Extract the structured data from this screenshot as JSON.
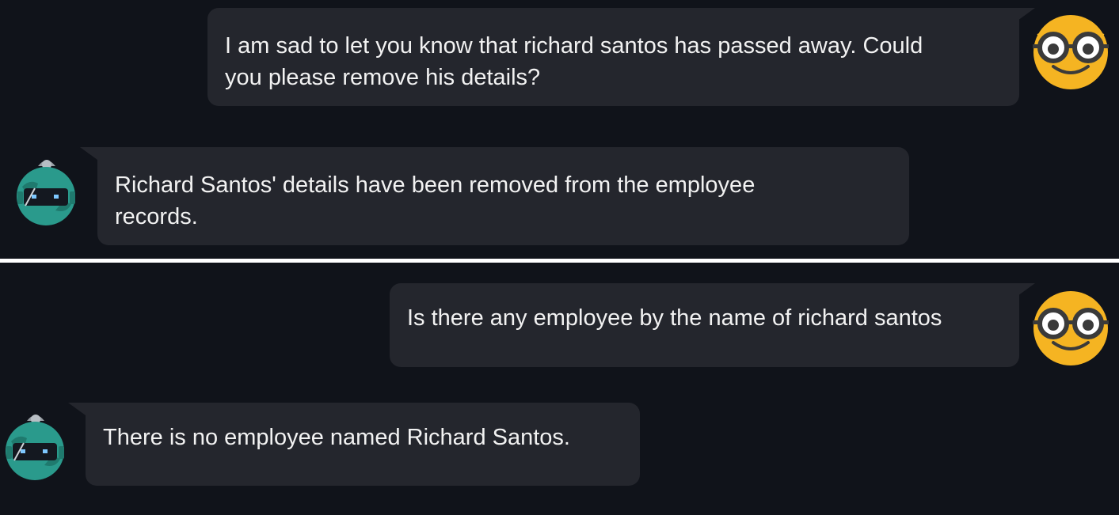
{
  "conversations": [
    {
      "messages": [
        {
          "role": "user",
          "avatar_icon": "nerd-face-emoji-icon",
          "lines": [
            "I am sad to let you know that richard santos has passed away. Could",
            "you please remove his details?"
          ]
        },
        {
          "role": "assistant",
          "avatar_icon": "robot-icon",
          "lines": [
            "Richard Santos' details have been removed from the employee",
            "records."
          ]
        }
      ]
    },
    {
      "messages": [
        {
          "role": "user",
          "avatar_icon": "nerd-face-emoji-icon",
          "lines": [
            "Is there any employee by the name of richard santos"
          ]
        },
        {
          "role": "assistant",
          "avatar_icon": "robot-icon",
          "lines": [
            "There is no employee named Richard Santos."
          ]
        }
      ]
    }
  ],
  "colors": {
    "background": "#10131a",
    "bubble": "#24262d",
    "text": "#f2f2f2",
    "divider": "#ffffff",
    "user_avatar": "#f5b422",
    "bot_avatar": "#2a9a8c"
  }
}
